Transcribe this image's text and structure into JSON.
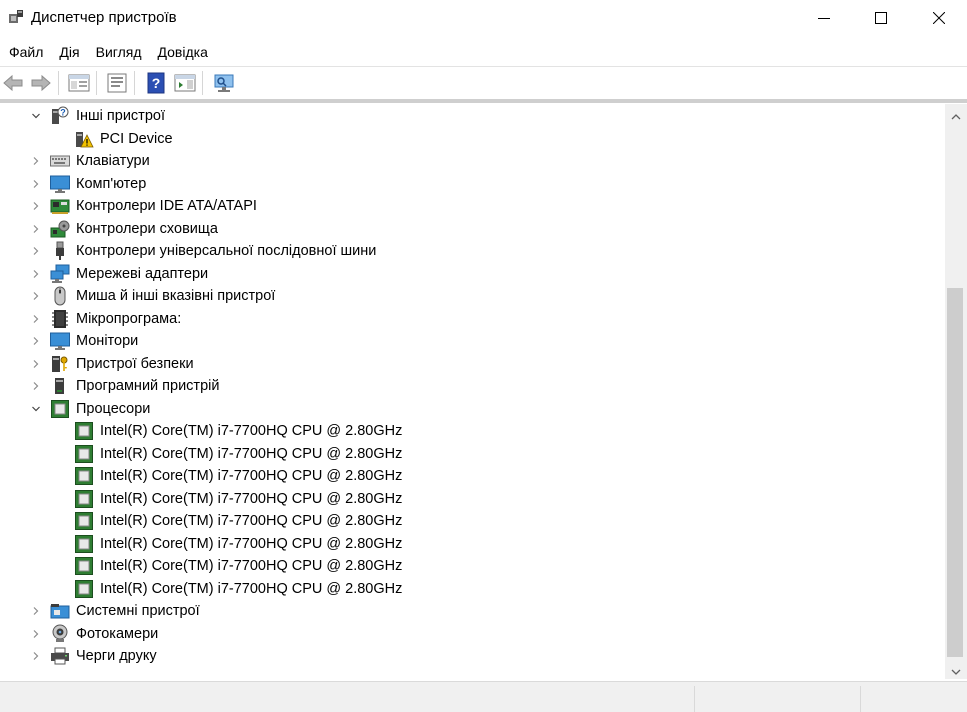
{
  "window": {
    "title": "Диспетчер пристроїв",
    "icon": "device-manager-icon"
  },
  "menu": [
    "Файл",
    "Дія",
    "Вигляд",
    "Довідка"
  ],
  "toolbar": {
    "buttons": [
      "back-arrow-icon",
      "forward-arrow-icon",
      "show-hide-console-tree-icon",
      "properties-icon",
      "help-icon",
      "action-pane-icon",
      "scan-hardware-icon"
    ]
  },
  "tree": [
    {
      "label": "Інші пристрої",
      "expanded": true,
      "icon": "unknown-device-icon"
    },
    {
      "label": "PCI Device",
      "icon": "warning-device-icon"
    },
    {
      "label": "Клавіатури",
      "expanded": false,
      "icon": "keyboard-icon"
    },
    {
      "label": "Комп'ютер",
      "expanded": false,
      "icon": "computer-icon"
    },
    {
      "label": "Контролери IDE ATA/ATAPI",
      "expanded": false,
      "icon": "ide-controller-icon"
    },
    {
      "label": "Контролери сховища",
      "expanded": false,
      "icon": "storage-controller-icon"
    },
    {
      "label": "Контролери універсальної послідовної шини",
      "expanded": false,
      "icon": "usb-icon"
    },
    {
      "label": "Мережеві адаптери",
      "expanded": false,
      "icon": "network-adapter-icon"
    },
    {
      "label": "Миша й інші вказівні пристрої",
      "expanded": false,
      "icon": "mouse-icon"
    },
    {
      "label": "Мікропрограма:",
      "expanded": false,
      "icon": "firmware-icon"
    },
    {
      "label": "Монітори",
      "expanded": false,
      "icon": "monitor-icon"
    },
    {
      "label": "Пристрої безпеки",
      "expanded": false,
      "icon": "security-device-icon"
    },
    {
      "label": "Програмний пристрій",
      "expanded": false,
      "icon": "software-device-icon"
    },
    {
      "label": "Процесори",
      "expanded": true,
      "icon": "processor-icon"
    },
    {
      "label": "Intel(R) Core(TM) i7-7700HQ CPU @ 2.80GHz",
      "icon": "processor-icon"
    },
    {
      "label": "Intel(R) Core(TM) i7-7700HQ CPU @ 2.80GHz",
      "icon": "processor-icon"
    },
    {
      "label": "Intel(R) Core(TM) i7-7700HQ CPU @ 2.80GHz",
      "icon": "processor-icon"
    },
    {
      "label": "Intel(R) Core(TM) i7-7700HQ CPU @ 2.80GHz",
      "icon": "processor-icon"
    },
    {
      "label": "Intel(R) Core(TM) i7-7700HQ CPU @ 2.80GHz",
      "icon": "processor-icon"
    },
    {
      "label": "Intel(R) Core(TM) i7-7700HQ CPU @ 2.80GHz",
      "icon": "processor-icon"
    },
    {
      "label": "Intel(R) Core(TM) i7-7700HQ CPU @ 2.80GHz",
      "icon": "processor-icon"
    },
    {
      "label": "Intel(R) Core(TM) i7-7700HQ CPU @ 2.80GHz",
      "icon": "processor-icon"
    },
    {
      "label": "Системні пристрої",
      "expanded": false,
      "icon": "system-devices-icon"
    },
    {
      "label": "Фотокамери",
      "expanded": false,
      "icon": "camera-icon"
    },
    {
      "label": "Черги друку",
      "expanded": false,
      "icon": "print-queue-icon"
    }
  ],
  "colors": {
    "processor_green": "#2e7d32",
    "monitor_blue": "#3a8fd6",
    "warning_yellow": "#f2c200"
  }
}
